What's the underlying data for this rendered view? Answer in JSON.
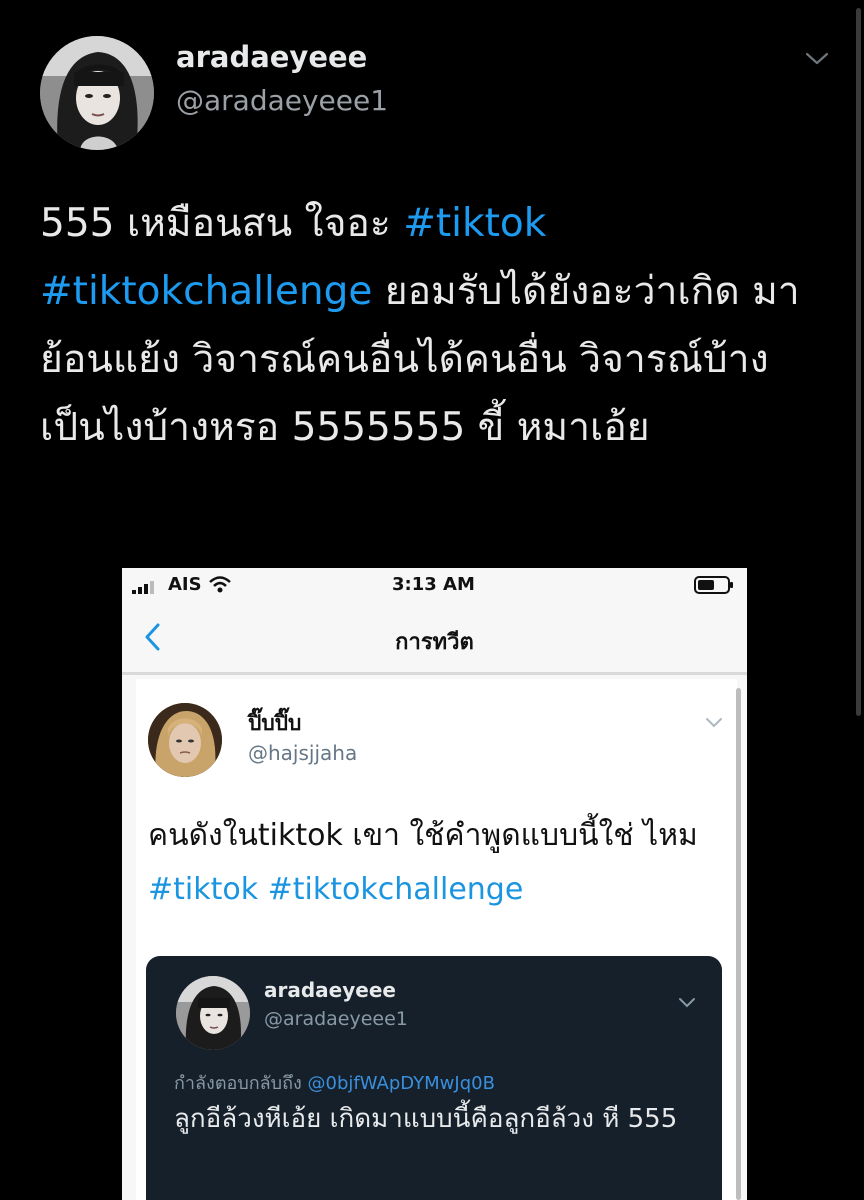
{
  "outer_tweet": {
    "display_name": "aradaeyeee",
    "handle": "@aradaeyeee1",
    "text_parts": {
      "p1": "555 เหมือนสน ใจอะ ",
      "tag1": "#tiktok",
      "tag2": "#tiktokchallenge",
      "p2": " ยอมรับได้ยังอะว่าเกิด มาย้อนแย้ง วิจารณ์คนอื่นได้คนอื่น วิจารณ์บ้างเป็นไงบ้างหรอ 5555555 ขี้ หมาเอ้ย"
    },
    "menu_icon": "chevron-down-icon"
  },
  "screenshot": {
    "status_bar": {
      "carrier": "AIS",
      "time": "3:13 AM"
    },
    "nav": {
      "title": "การทวีต",
      "back_icon": "chevron-left-icon"
    },
    "tweet": {
      "display_name": "ปิ๊บปิ๊บ",
      "handle": "@hajsjjaha",
      "text": "คนดังในtiktok เขา ใช้คำพูดแบบนี้ใช่ ไหม ",
      "tag1": "#tiktok",
      "tag2": "#tiktokchallenge"
    },
    "quoted": {
      "display_name": "aradaeyeee",
      "handle": "@aradaeyeee1",
      "reply_prefix": "กำลังตอบกลับถึง ",
      "reply_mention": "@0bjfWApDYMwJq0B",
      "text": "ลูกอีล้วงหีเอ้ย เกิดมาแบบนี้คือลูกอีล้วง หี 555"
    }
  },
  "colors": {
    "background": "#000000",
    "hashtag": "#1d9bf0",
    "quote_bg": "#15202b",
    "phone_bg": "#f7f7f7"
  }
}
